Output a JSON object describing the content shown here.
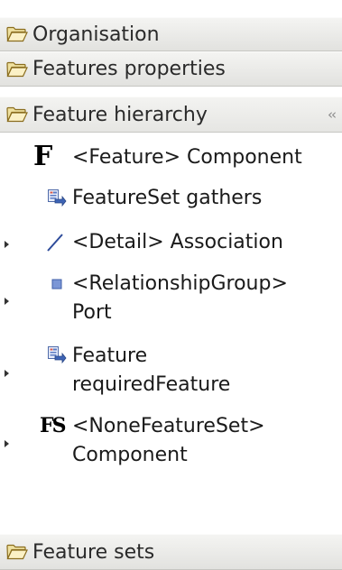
{
  "sections": {
    "organisation": {
      "label": "Organisation",
      "icon": "folder-open-icon"
    },
    "features_properties": {
      "label": "Features properties",
      "icon": "folder-open-icon"
    },
    "feature_hierarchy": {
      "label": "Feature hierarchy",
      "icon": "folder-open-icon",
      "collapse_icon": "double-chevron-left-icon"
    },
    "feature_sets": {
      "label": "Feature sets",
      "icon": "folder-open-icon"
    }
  },
  "tree_items": [
    {
      "label": "<Feature> Component",
      "icon": "feature-F-icon",
      "icon_glyph": "F",
      "expandable": false
    },
    {
      "label": "FeatureSet gathers",
      "icon": "featureset-gathers-icon",
      "expandable": false
    },
    {
      "label": "<Detail> Association",
      "icon": "association-line-icon",
      "expandable": true
    },
    {
      "label_line1": "<RelationshipGroup>",
      "label_line2": "Port",
      "icon": "port-square-icon",
      "expandable": true
    },
    {
      "label_line1": "Feature",
      "label_line2": "requiredFeature",
      "icon": "required-feature-icon",
      "expandable": true
    },
    {
      "label_line1": "<NoneFeatureSet>",
      "label_line2": "Component",
      "icon": "feature-set-FS-icon",
      "icon_glyph": "FS",
      "expandable": true
    }
  ],
  "colors": {
    "folder_fill": "#f5e7a8",
    "folder_stroke": "#8a6d1e",
    "port_blue": "#5b7bc2",
    "association_blue": "#2d4b9a"
  }
}
